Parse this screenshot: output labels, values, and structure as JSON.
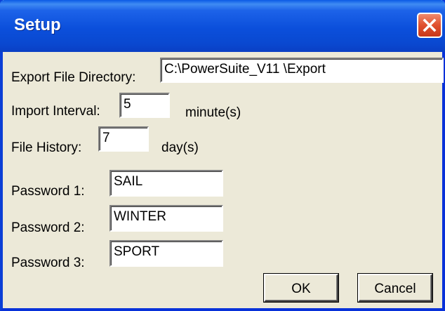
{
  "window": {
    "title": "Setup",
    "close_icon": "close-icon"
  },
  "export": {
    "label": "Export File Directory:",
    "value": "C:\\PowerSuite_V11 \\Export"
  },
  "import_interval": {
    "label": "Import Interval:",
    "value": "5",
    "unit": "minute(s)"
  },
  "file_history": {
    "label": "File History:",
    "value": "7",
    "unit": "day(s)"
  },
  "passwords": [
    {
      "label": "Password 1:",
      "value": "SAIL"
    },
    {
      "label": "Password 2:",
      "value": "WINTER"
    },
    {
      "label": "Password 3:",
      "value": "SPORT"
    }
  ],
  "buttons": {
    "ok": "OK",
    "cancel": "Cancel"
  },
  "colors": {
    "titlebar": "#0a48d0",
    "close": "#e0502e",
    "background": "#ece9d8"
  }
}
